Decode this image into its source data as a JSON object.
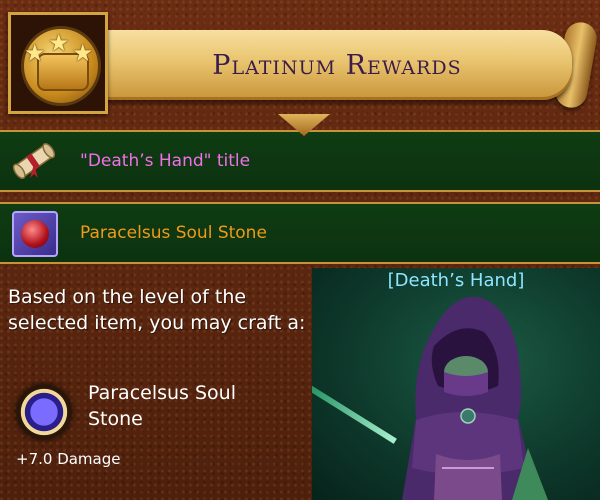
{
  "header": {
    "title": "Platinum Rewards",
    "medal_icon": "three-star-medal-icon"
  },
  "rewards": [
    {
      "label": "\"Death’s Hand\" title",
      "icon": "scroll-icon",
      "color": "#f070e8"
    },
    {
      "label": "Paracelsus Soul Stone",
      "icon": "red-gem-icon",
      "color": "#f09a1a"
    }
  ],
  "craft": {
    "intro": "Based on the level of the selected item, you may craft a:",
    "item_name": "Paracelsus Soul Stone",
    "item_icon": "soul-orb-icon",
    "stat": "+7.0 Damage"
  },
  "preview": {
    "label": "[Death’s Hand]"
  },
  "colors": {
    "leather": "#5a260f",
    "row_green": "#0f3c12",
    "gold": "#d4a43e",
    "preview_label": "#8ce6ff"
  }
}
